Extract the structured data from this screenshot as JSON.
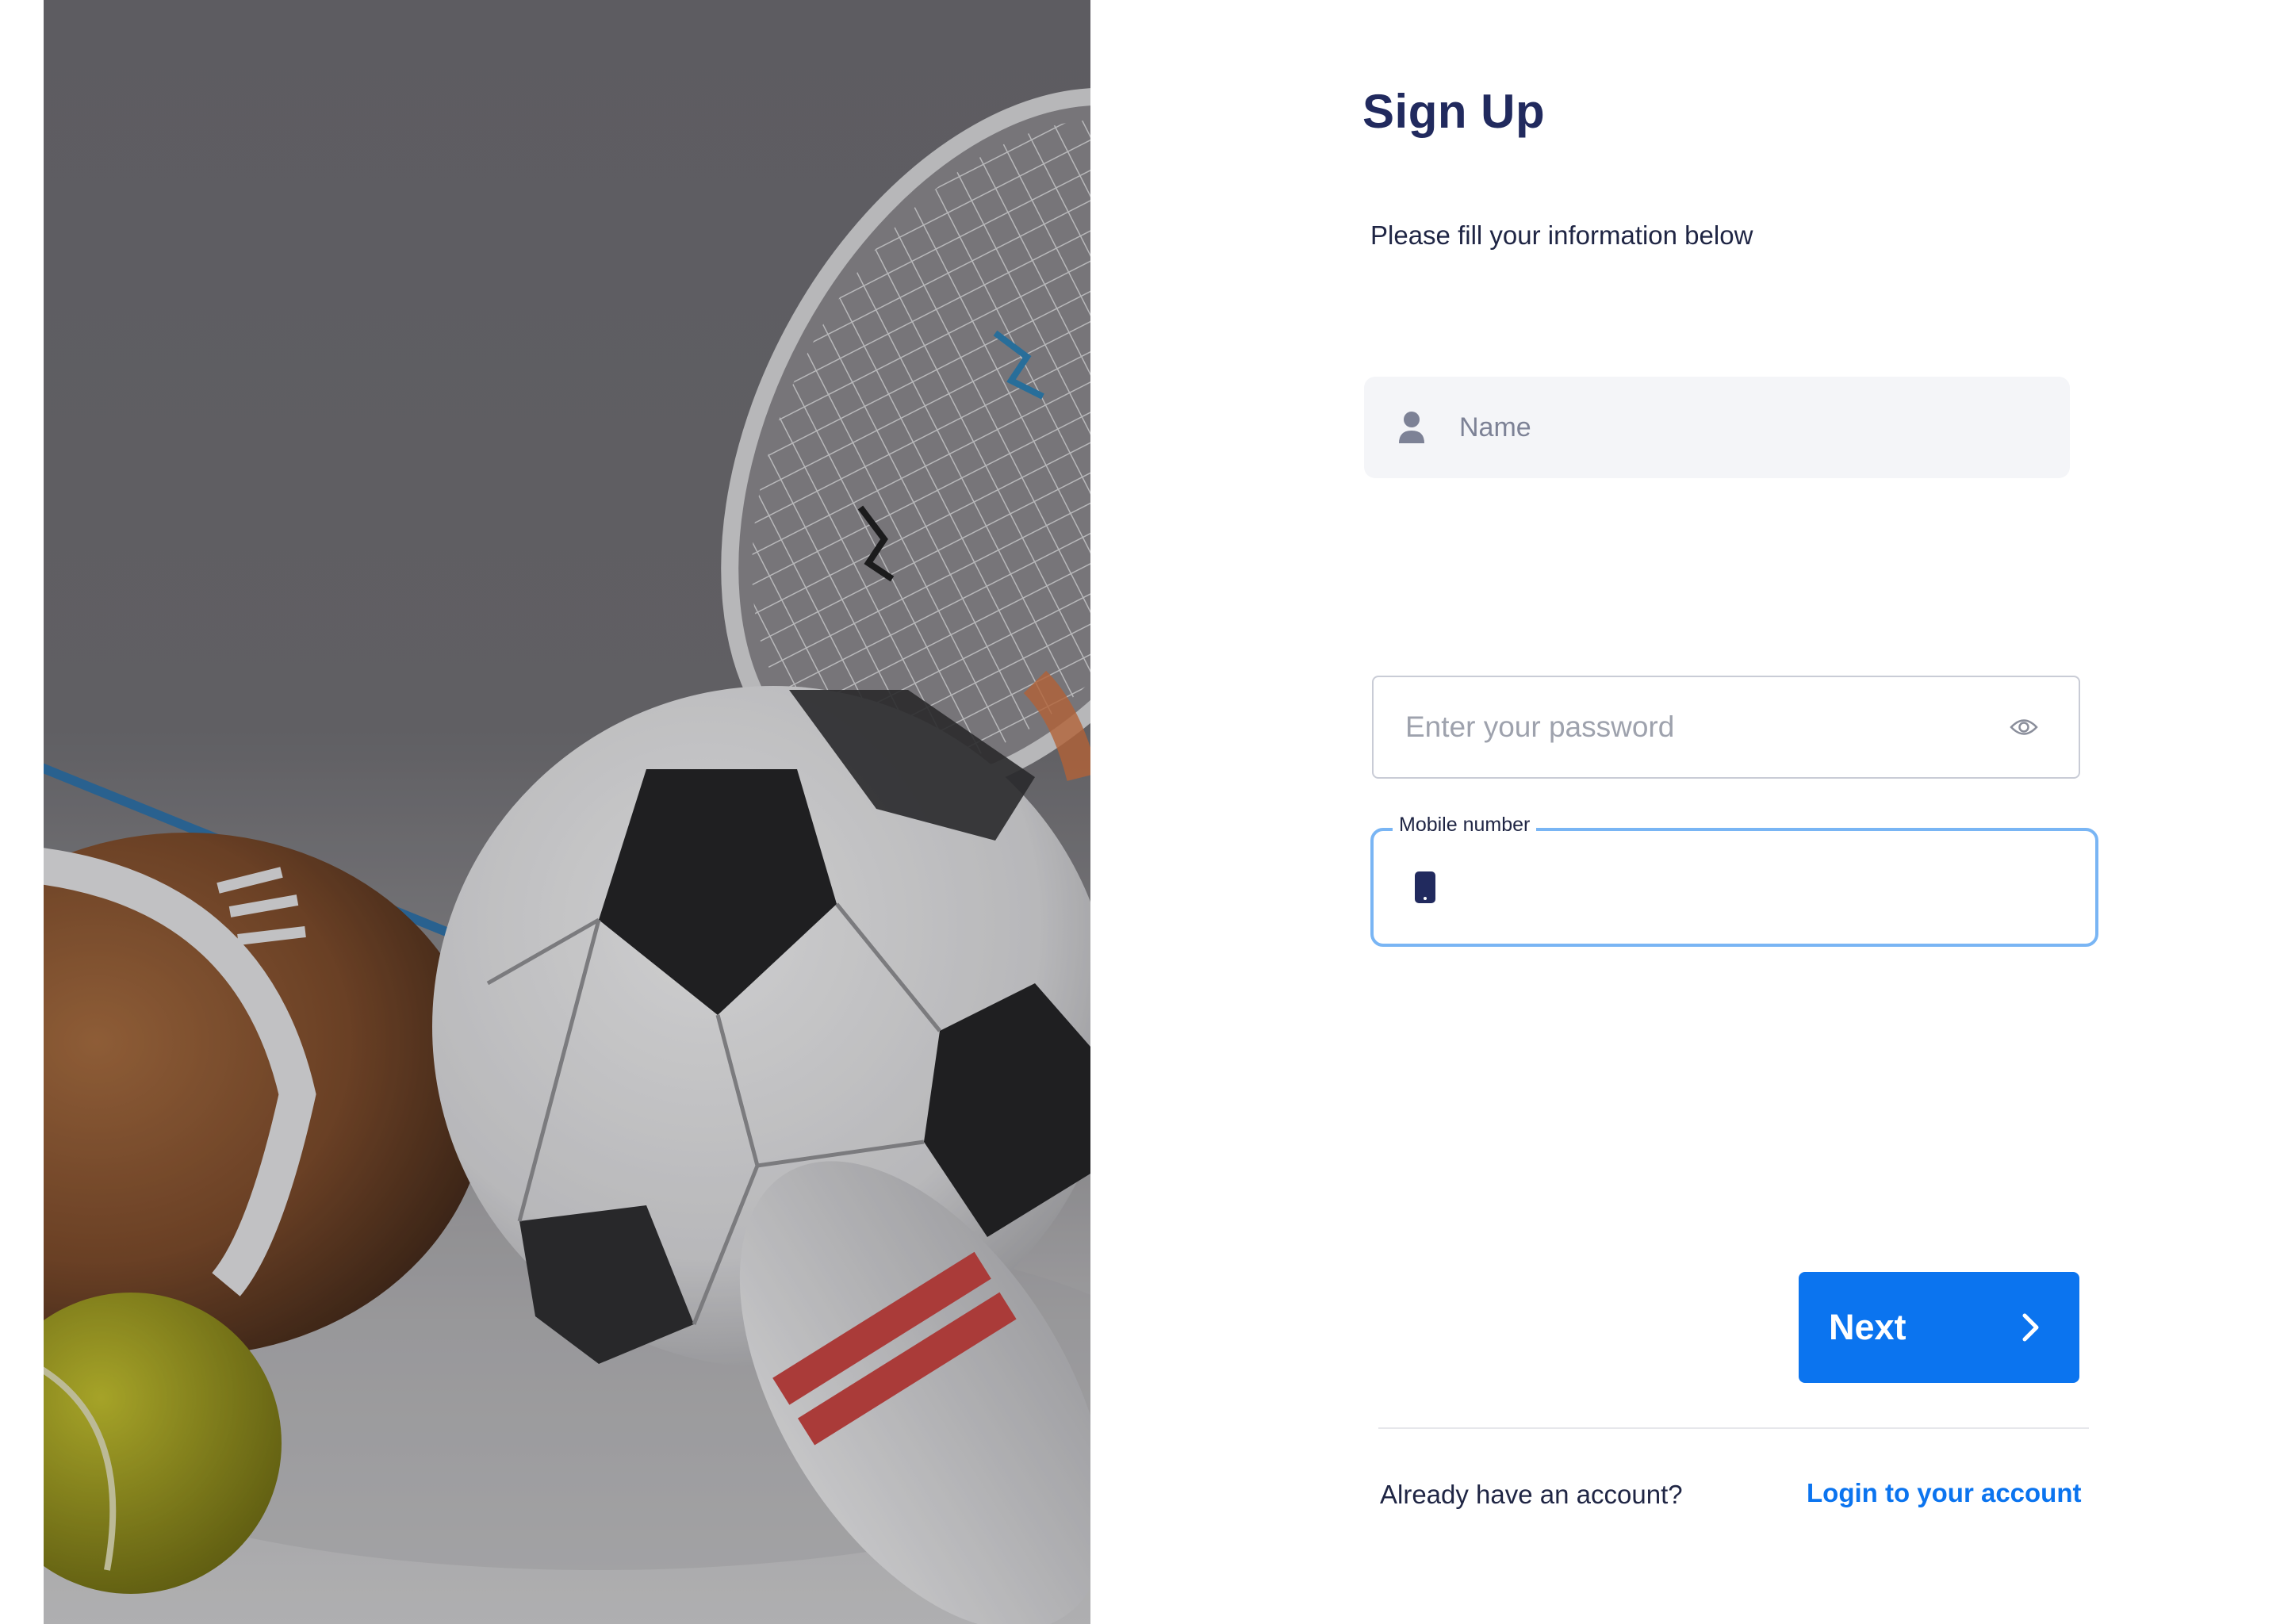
{
  "signup": {
    "title": "Sign Up",
    "subtitle": "Please fill your information below",
    "name_placeholder": "Name",
    "password_placeholder": "Enter your password",
    "mobile_label": "Mobile number",
    "mobile_value": "",
    "next_label": "Next",
    "footer_text": "Already have an account?",
    "footer_link": "Login to your account"
  },
  "icons": {
    "name": "user-icon",
    "password_toggle": "eye-icon",
    "mobile": "phone-icon",
    "next": "chevron-right-icon"
  },
  "colors": {
    "title": "#212a5e",
    "primary": "#0b74ef",
    "focus_border": "#79b5f4",
    "input_bg": "#f4f5f8"
  }
}
